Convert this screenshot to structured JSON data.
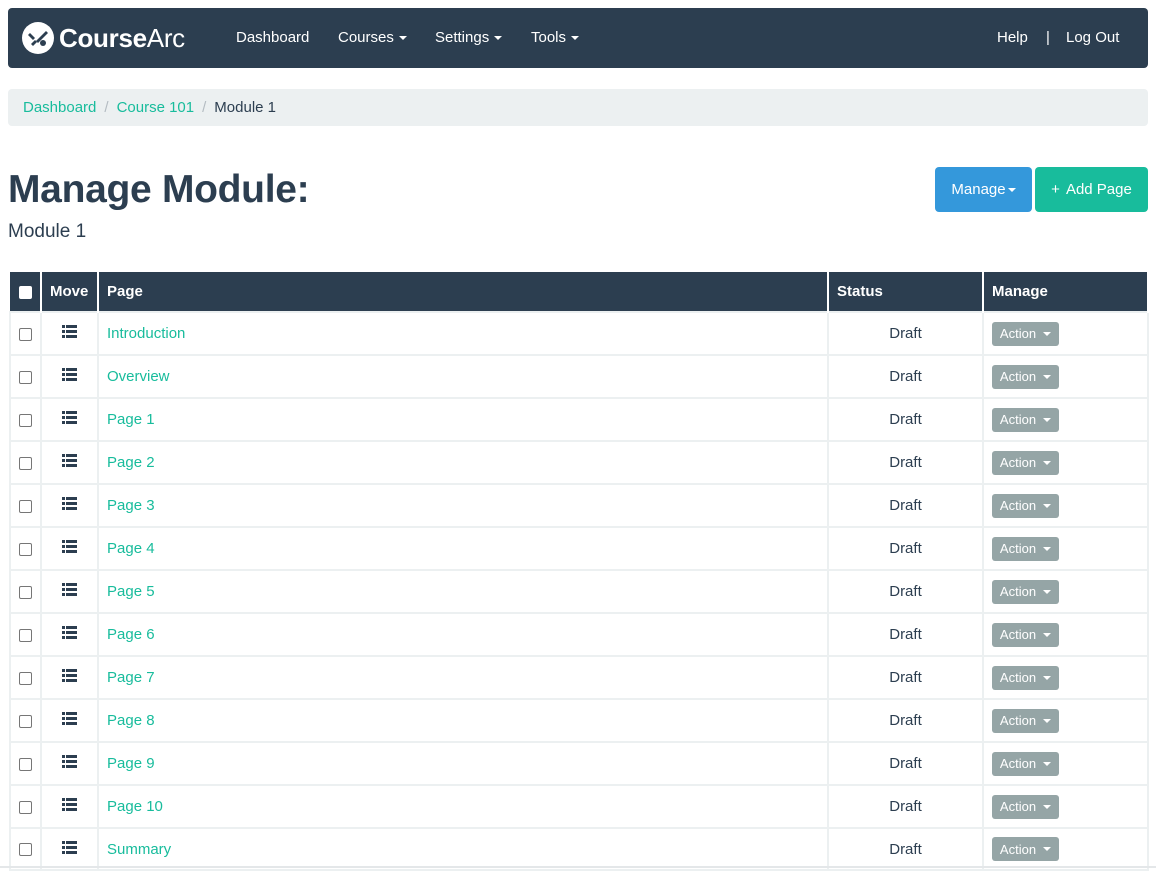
{
  "navbar": {
    "brand_bold": "Course",
    "brand_light": "Arc",
    "items": [
      {
        "label": "Dashboard"
      },
      {
        "label": "Courses"
      },
      {
        "label": "Settings"
      },
      {
        "label": "Tools"
      }
    ],
    "help": "Help",
    "separator": "|",
    "logout": "Log Out"
  },
  "breadcrumb": {
    "items": [
      "Dashboard",
      "Course 101"
    ],
    "separator": "/",
    "current": "Module 1"
  },
  "page": {
    "title": "Manage Module:",
    "subtitle": "Module 1"
  },
  "buttons": {
    "manage": "Manage",
    "add_page": "Add Page",
    "add_icon": "+"
  },
  "table": {
    "headers": {
      "move": "Move",
      "page": "Page",
      "status": "Status",
      "manage": "Manage"
    },
    "action_label": "Action",
    "rows": [
      {
        "page": "Introduction",
        "status": "Draft"
      },
      {
        "page": "Overview",
        "status": "Draft"
      },
      {
        "page": "Page 1",
        "status": "Draft"
      },
      {
        "page": "Page 2",
        "status": "Draft"
      },
      {
        "page": "Page 3",
        "status": "Draft"
      },
      {
        "page": "Page 4",
        "status": "Draft"
      },
      {
        "page": "Page 5",
        "status": "Draft"
      },
      {
        "page": "Page 6",
        "status": "Draft"
      },
      {
        "page": "Page 7",
        "status": "Draft"
      },
      {
        "page": "Page 8",
        "status": "Draft"
      },
      {
        "page": "Page 9",
        "status": "Draft"
      },
      {
        "page": "Page 10",
        "status": "Draft"
      },
      {
        "page": "Summary",
        "status": "Draft"
      }
    ]
  },
  "colors": {
    "navbar": "#2c3e50",
    "link": "#18bc9c",
    "manage_button": "#3498db",
    "add_button": "#18bc9c",
    "action_button": "#95a5a6",
    "breadcrumb_bg": "#ecf0f1"
  }
}
